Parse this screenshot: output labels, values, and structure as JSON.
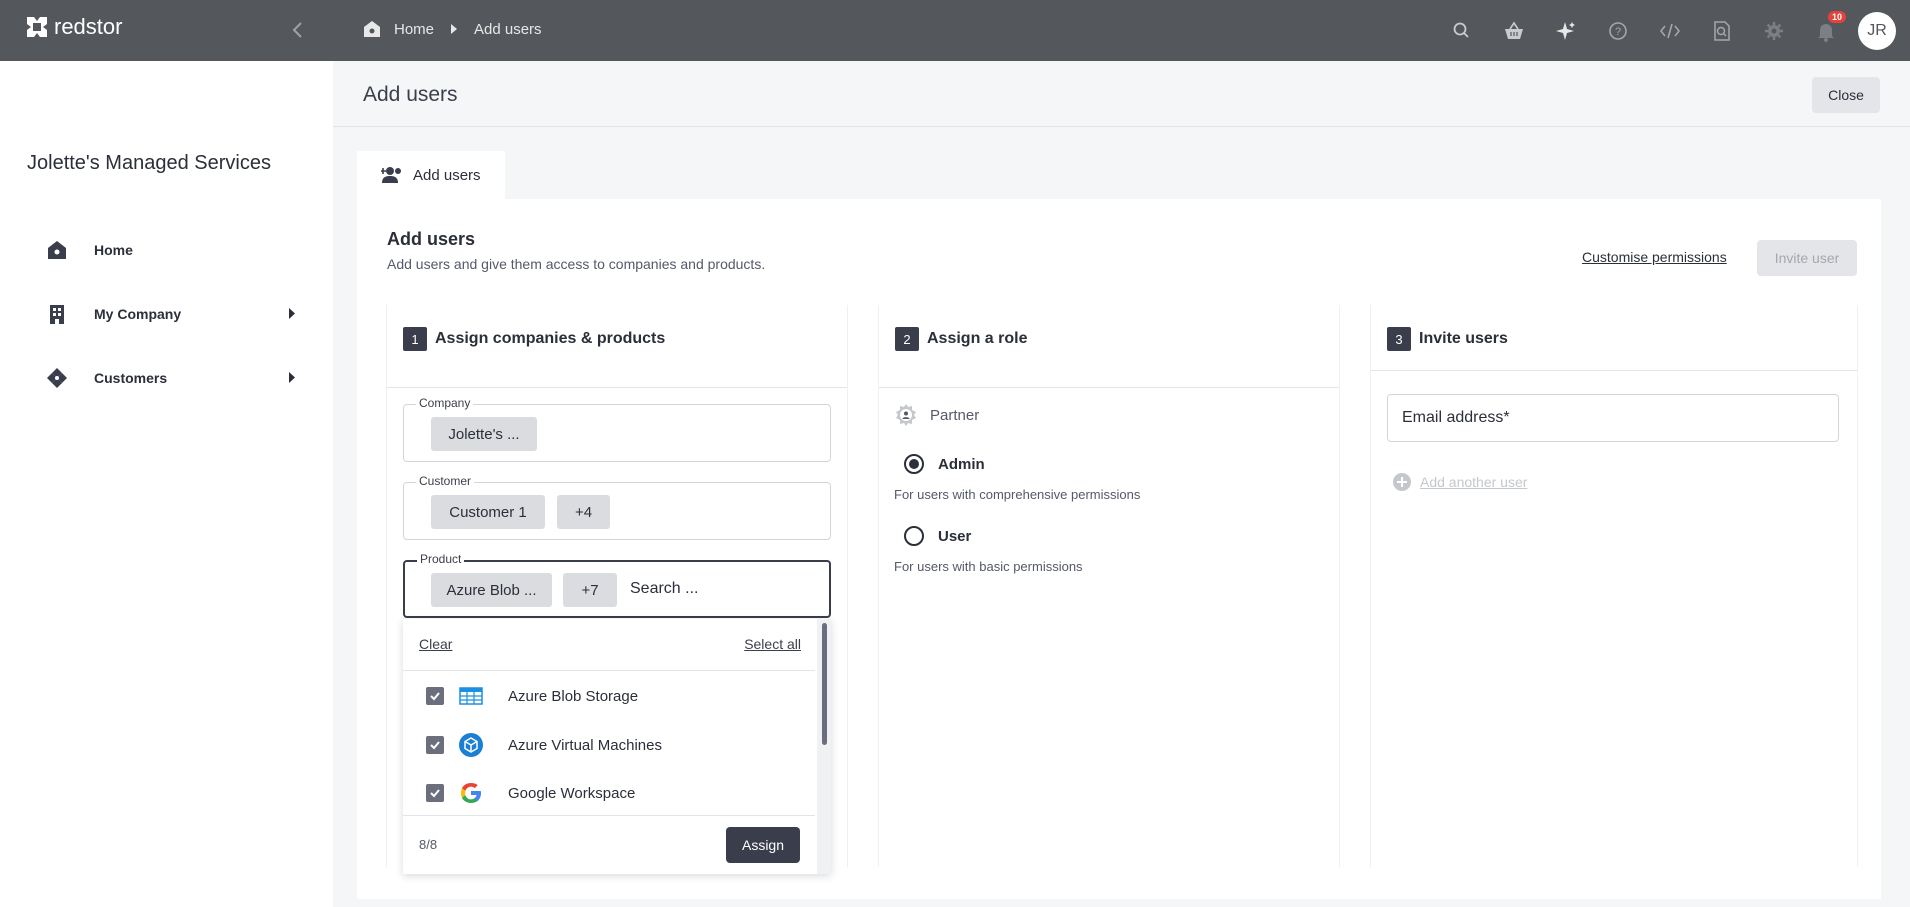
{
  "app": {
    "brand": "redstor"
  },
  "breadcrumb": {
    "home": "Home",
    "current": "Add users"
  },
  "notifications": {
    "count": "10"
  },
  "user": {
    "initials": "JR"
  },
  "sidebar": {
    "org_name": "Jolette's Managed Services",
    "items": [
      {
        "label": "Home",
        "icon": "home-icon",
        "has_children": false
      },
      {
        "label": "My Company",
        "icon": "building-icon",
        "has_children": true
      },
      {
        "label": "Customers",
        "icon": "customers-icon",
        "has_children": true
      }
    ]
  },
  "page": {
    "title": "Add users",
    "close_label": "Close"
  },
  "tab": {
    "label": "Add users"
  },
  "panel": {
    "title": "Add users",
    "subtitle": "Add users and give them access to companies and products.",
    "customise_label": "Customise permissions",
    "invite_label": "Invite user"
  },
  "steps": [
    {
      "num": "1",
      "title": "Assign companies & products"
    },
    {
      "num": "2",
      "title": "Assign a role"
    },
    {
      "num": "3",
      "title": "Invite users"
    }
  ],
  "company_field": {
    "legend": "Company",
    "chip": "Jolette's ..."
  },
  "customer_field": {
    "legend": "Customer",
    "chip": "Customer 1",
    "more": "+4"
  },
  "product_field": {
    "legend": "Product",
    "chip": "Azure Blob ...",
    "more": "+7",
    "placeholder": "Search ..."
  },
  "dropdown": {
    "clear_label": "Clear",
    "select_all_label": "Select all",
    "items": [
      {
        "label": "Azure Blob Storage",
        "checked": true,
        "icon": "azure-blob-icon"
      },
      {
        "label": "Azure Virtual Machines",
        "checked": true,
        "icon": "azure-vm-icon"
      },
      {
        "label": "Google Workspace",
        "checked": true,
        "icon": "google-icon"
      }
    ],
    "count": "8/8",
    "assign_label": "Assign"
  },
  "role": {
    "group": "Partner",
    "options": [
      {
        "label": "Admin",
        "desc": "For users with comprehensive permissions",
        "selected": true
      },
      {
        "label": "User",
        "desc": "For users with basic permissions",
        "selected": false
      }
    ]
  },
  "invite": {
    "email_placeholder": "Email address*",
    "add_another_label": "Add another user"
  },
  "colors": {
    "topbar": "#54575c",
    "primary": "#3a3d4b",
    "badge": "#e4423a"
  }
}
